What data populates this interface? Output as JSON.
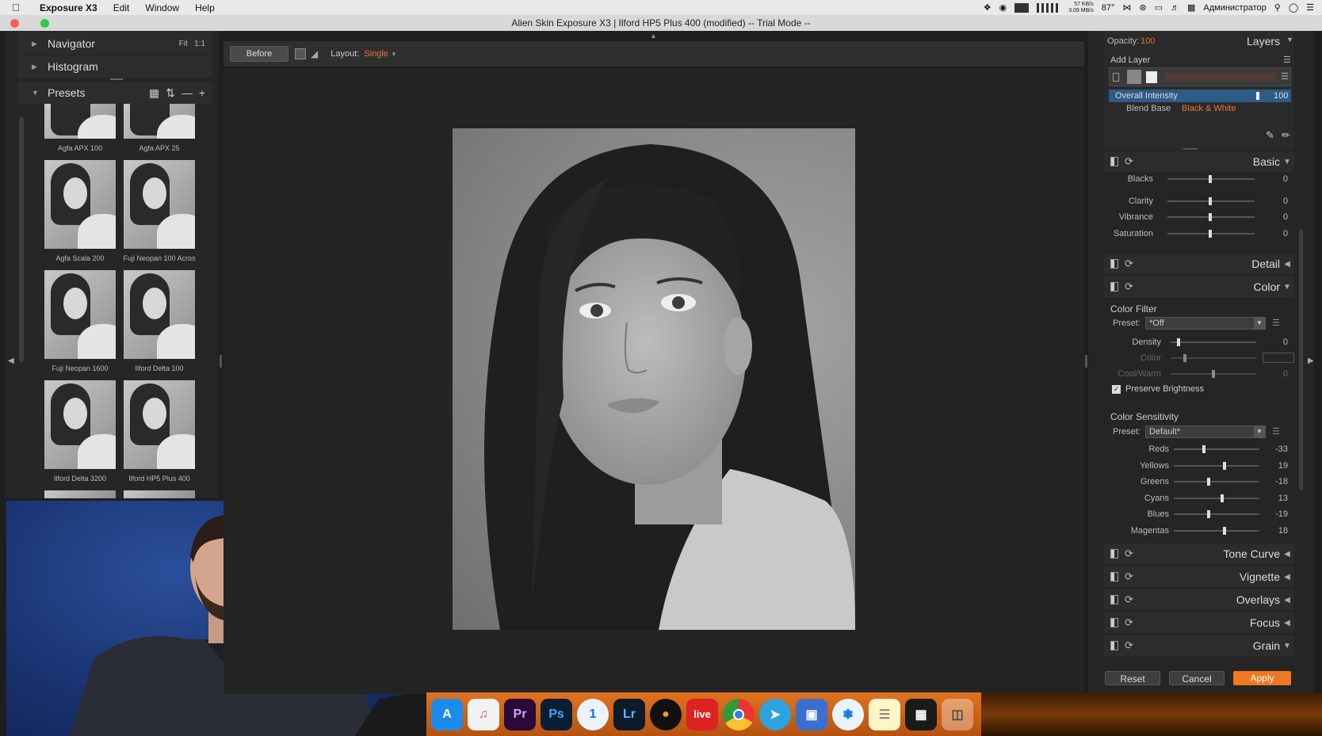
{
  "menubar": {
    "app": "Exposure X3",
    "items": [
      "Edit",
      "Window",
      "Help"
    ],
    "net_up": "57 KB/s",
    "net_down": "3.09 MB/s",
    "temp": "87°",
    "user": "Администратор"
  },
  "window": {
    "title": "Alien Skin Exposure X3 | Ilford HP5 Plus 400 (modified) -- Trial Mode --"
  },
  "left": {
    "navigator": "Navigator",
    "fit": "Fit",
    "one_to_one": "1:1",
    "histogram": "Histogram",
    "presets": "Presets",
    "thumbs": [
      "Agfa APX 100",
      "Agfa APX 25",
      "Agfa Scala 200",
      "Fuji Neopan 100 Acros",
      "Fuji Neopan 1600",
      "Ilford Delta 100",
      "Ilford Delta 3200",
      "Ilford HP5 Plus 400"
    ]
  },
  "toolbar": {
    "before": "Before",
    "layout_label": "Layout:",
    "layout_value": "Single"
  },
  "right": {
    "opacity_label": "Opacity:",
    "opacity_value": "100",
    "layers": "Layers",
    "add_layer": "Add Layer",
    "overall_intensity": "Overall Intensity",
    "overall_intensity_value": "100",
    "blend_base": "Blend Base",
    "blend_base_value": "Black & White",
    "basic": "Basic",
    "basic_sliders": [
      {
        "label": "Blacks",
        "value": "0"
      },
      {
        "label": "Clarity",
        "value": "0"
      },
      {
        "label": "Vibrance",
        "value": "0"
      },
      {
        "label": "Saturation",
        "value": "0"
      }
    ],
    "detail": "Detail",
    "color": "Color",
    "color_filter": "Color Filter",
    "preset_label": "Preset:",
    "color_filter_preset": "*Off",
    "density": "Density",
    "density_value": "0",
    "color_lbl": "Color",
    "coolwarm": "Cool/Warm",
    "coolwarm_value": "0",
    "preserve_brightness": "Preserve Brightness",
    "color_sensitivity": "Color Sensitivity",
    "sensitivity_preset": "Default*",
    "sensitivity": [
      {
        "label": "Reds",
        "value": "-33"
      },
      {
        "label": "Yellows",
        "value": "19"
      },
      {
        "label": "Greens",
        "value": "-18"
      },
      {
        "label": "Cyans",
        "value": "13"
      },
      {
        "label": "Blues",
        "value": "-19"
      },
      {
        "label": "Magentas",
        "value": "18"
      }
    ],
    "tone_curve": "Tone Curve",
    "vignette": "Vignette",
    "overlays": "Overlays",
    "focus": "Focus",
    "grain": "Grain",
    "reset": "Reset",
    "cancel": "Cancel",
    "apply": "Apply"
  },
  "dock": {
    "icons": [
      "App Store",
      "iTunes",
      "Premiere",
      "Photoshop",
      "1Password",
      "Lightroom",
      "Alien Skin",
      "Live",
      "Chrome",
      "Telegram",
      "Keynote",
      "Safari",
      "Notes",
      "Finder",
      "Trash"
    ],
    "labels": {
      "premiere": "Pr",
      "photoshop": "Ps",
      "lightroom": "Lr",
      "live": "live",
      "onepass": "1"
    }
  },
  "colors": {
    "accent": "#e8743a",
    "apply": "#f07820",
    "panel": "#252525"
  }
}
